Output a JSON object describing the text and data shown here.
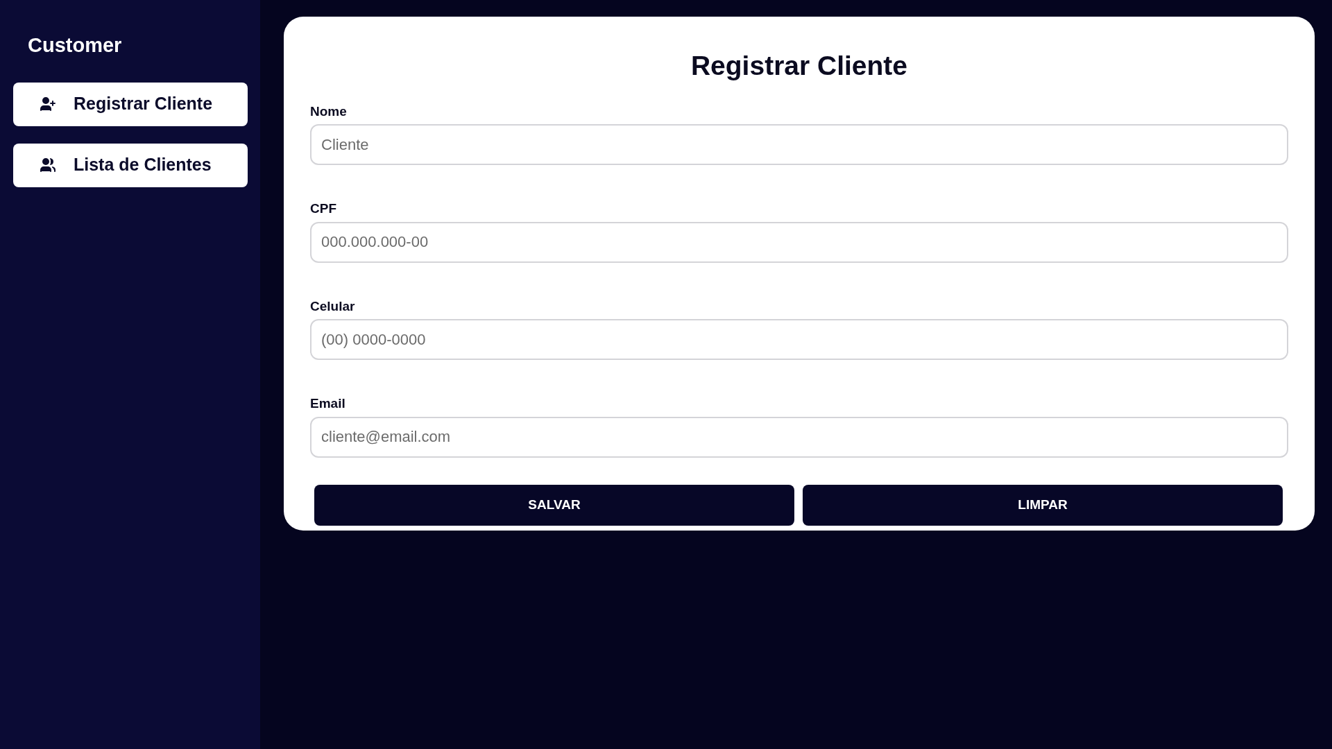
{
  "sidebar": {
    "title": "Customer",
    "items": [
      {
        "label": "Registrar Cliente",
        "kind": "add-user"
      },
      {
        "label": "Lista de Clientes",
        "kind": "users"
      }
    ]
  },
  "form": {
    "title": "Registrar Cliente",
    "fields": [
      {
        "label": "Nome",
        "placeholder": "Cliente"
      },
      {
        "label": "CPF",
        "placeholder": "000.000.000-00"
      },
      {
        "label": "Celular",
        "placeholder": "(00) 0000-0000"
      },
      {
        "label": "Email",
        "placeholder": "cliente@email.com"
      }
    ],
    "buttons": [
      "SALVAR",
      "LIMPAR"
    ]
  }
}
